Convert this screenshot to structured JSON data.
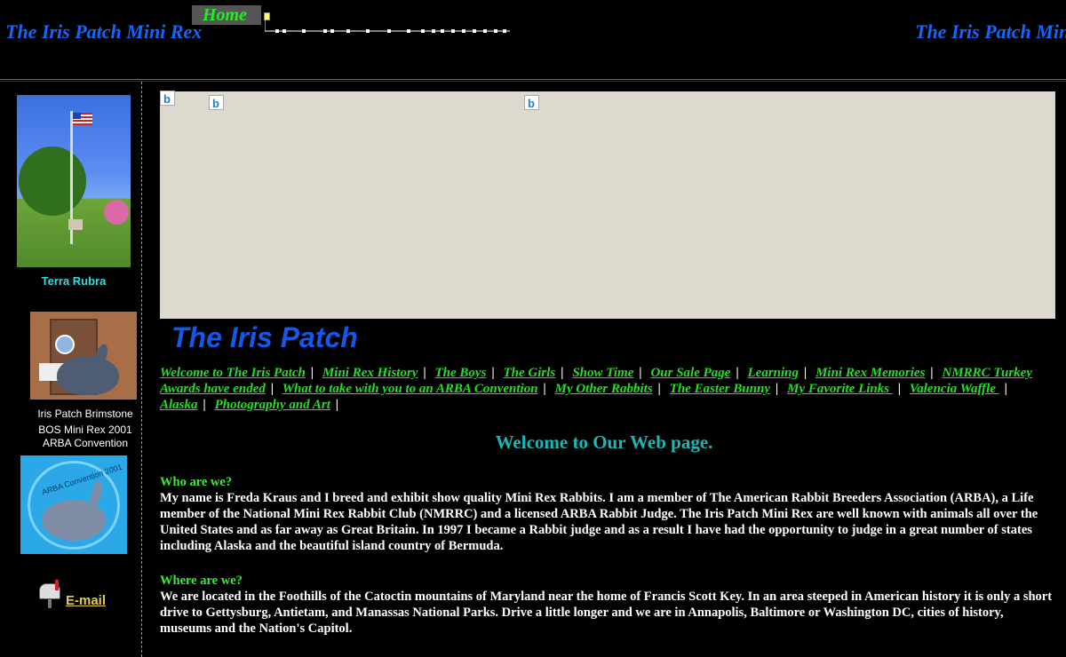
{
  "header": {
    "site_name_left": "The Iris Patch Mini Rex",
    "site_name_right": "The Iris Patch Mini Rex",
    "home_label": "Home"
  },
  "sidebar": {
    "photo1_caption": "Terra Rubra",
    "photo2_caption_line1": "Iris Patch Brimstone",
    "photo2_caption_line2": "BOS Mini Rex 2001",
    "photo2_caption_line3": "ARBA Convention",
    "photo3_text": "ARBA Convention 2001",
    "email_label": "E-mail"
  },
  "main": {
    "title": "The Iris Patch",
    "nav_links": [
      "Welcome  to The Iris Patch",
      "Mini Rex History",
      "The Boys",
      "The Girls",
      "Show Time",
      "Our Sale Page",
      "Learning",
      " Mini Rex Memories",
      "NMRRC Turkey  Awards have ended",
      "What to take with you  to an ARBA Convention",
      "My Other Rabbits",
      "The Easter Bunny",
      "My Favorite Links ",
      "  Valencia Waffle ",
      "Alaska",
      "Photography and Art"
    ],
    "welcome_heading": "Welcome to Our Web page.",
    "section1_heading": "Who are we?",
    "section1_text": "My name is Freda Kraus and I breed  and exhibit   show quality Mini Rex Rabbits.  I am a member of The American Rabbit Breeders Association (ARBA),  a Life member of the National Mini Rex Rabbit Club (NMRRC) and a licensed ARBA Rabbit Judge.  The  Iris Patch Mini Rex are well known  with  animals all over the United States  and as far away as Great Britain.   In 1997  I became a Rabbit judge and as a result I have had the opportunity to  judge  in a great number of states  including Alaska  and  the beautiful island country of Bermuda.",
    "section2_heading": "Where are we?",
    "section2_text": "We are located in the Foothills  of the Catoctin mountains of Maryland near the home of Francis Scott Key.   In an area steeped in American history it is only a short drive to  Gettysburg,  Antietam, and  Manassas National Parks.  Drive a little longer and we are  in Annapolis,  Baltimore or Washington DC, cities of history,  museums and the Nation's Capitol."
  },
  "colors": {
    "background": "#000000",
    "header_title": "#1565ff",
    "nav_link": "#22e022",
    "welcome": "#19b8b8",
    "section_heading": "#33ee33",
    "banner": "#ddd9cf"
  }
}
